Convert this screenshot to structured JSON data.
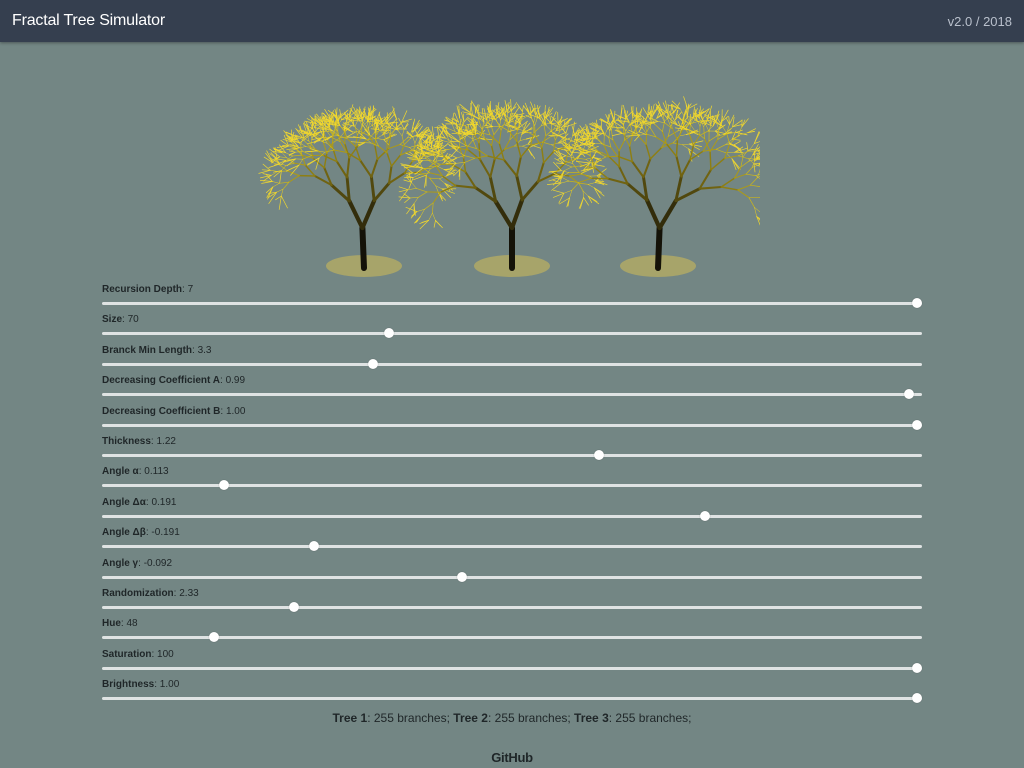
{
  "header": {
    "title": "Fractal Tree Simulator",
    "version": "v2.0 / 2018"
  },
  "trees": [
    {
      "name": "tree-1"
    },
    {
      "name": "tree-2"
    },
    {
      "name": "tree-3"
    }
  ],
  "controls": [
    {
      "name": "recursion-depth",
      "label": "Recursion Depth",
      "value": "7",
      "position": 1.0
    },
    {
      "name": "size",
      "label": "Size",
      "value": "70",
      "position": 0.352
    },
    {
      "name": "branch-min-length",
      "label": "Branck Min Length",
      "value": "3.3",
      "position": 0.332
    },
    {
      "name": "decreasing-coefficient-a",
      "label": "Decreasing Coefficient A",
      "value": "0.99",
      "position": 0.99
    },
    {
      "name": "decreasing-coefficient-b",
      "label": "Decreasing Coefficient B",
      "value": "1.00",
      "position": 1.0
    },
    {
      "name": "thickness",
      "label": "Thickness",
      "value": "1.22",
      "position": 0.61
    },
    {
      "name": "angle-alpha",
      "label": "Angle α",
      "value": "0.113",
      "position": 0.15
    },
    {
      "name": "angle-delta-alpha",
      "label": "Angle Δα",
      "value": "0.191",
      "position": 0.74
    },
    {
      "name": "angle-delta-beta",
      "label": "Angle Δβ",
      "value": "-0.191",
      "position": 0.26
    },
    {
      "name": "angle-gamma",
      "label": "Angle γ",
      "value": "-0.092",
      "position": 0.442
    },
    {
      "name": "randomization",
      "label": "Randomization",
      "value": "2.33",
      "position": 0.236
    },
    {
      "name": "hue",
      "label": "Hue",
      "value": "48",
      "position": 0.138
    },
    {
      "name": "saturation",
      "label": "Saturation",
      "value": "100",
      "position": 1.0
    },
    {
      "name": "brightness",
      "label": "Brightness",
      "value": "1.00",
      "position": 1.0
    }
  ],
  "summary": {
    "t1_label": "Tree 1",
    "t1_text": ": 255 branches; ",
    "t2_label": "Tree 2",
    "t2_text": ": 255 branches; ",
    "t3_label": "Tree 3",
    "t3_text": ": 255 branches;"
  },
  "footer": {
    "github": "GitHub"
  },
  "colors": {
    "background": "#738684",
    "header": "#353f4f",
    "foliage": "#e8cf2a",
    "ground": "#a7a46a"
  }
}
